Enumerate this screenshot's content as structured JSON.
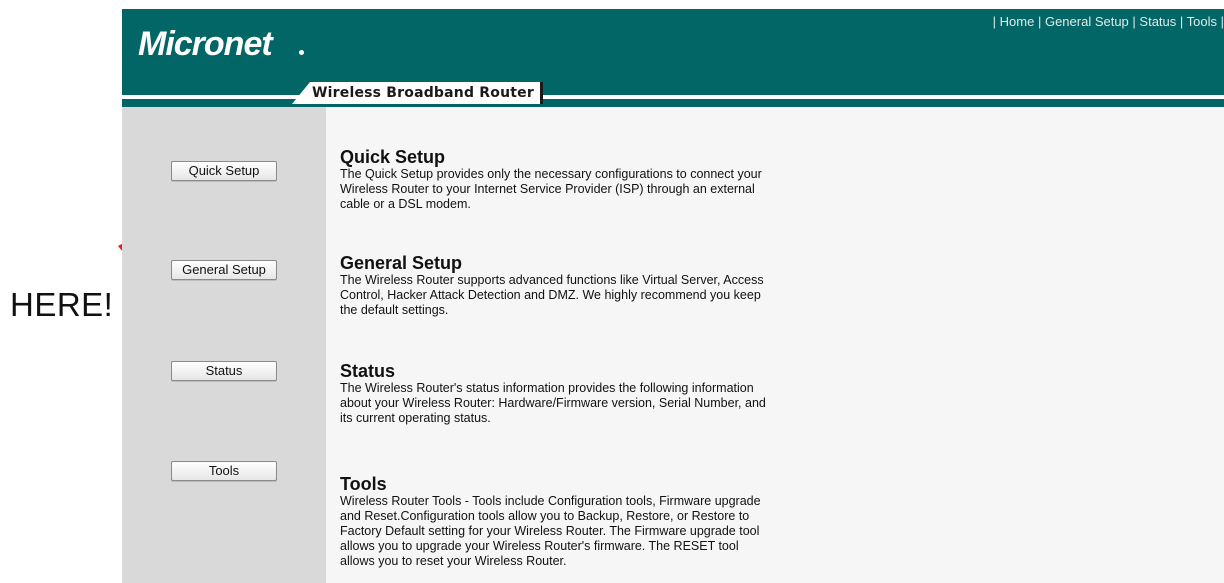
{
  "annotation": {
    "label": "HERE!",
    "arrow_color": "#ee1c1c"
  },
  "header": {
    "brand": "Micronet",
    "product": "Wireless Broadband Router",
    "links": [
      "Home",
      "General Setup",
      "Status",
      "Tools"
    ],
    "background": "#036666"
  },
  "sidebar": {
    "buttons": [
      {
        "label": "Quick Setup"
      },
      {
        "label": "General Setup"
      },
      {
        "label": "Status"
      },
      {
        "label": "Tools"
      }
    ]
  },
  "sections": [
    {
      "title": "Quick Setup",
      "lines": [
        "The Quick Setup provides only the necessary configurations to connect your",
        "Wireless Router to your Internet Service Provider (ISP) through an external",
        "cable or a DSL modem."
      ]
    },
    {
      "title": "General Setup",
      "lines": [
        "The Wireless Router supports advanced functions like Virtual Server, Access",
        "Control, Hacker Attack Detection and DMZ. We highly recommend you keep",
        "the default settings."
      ]
    },
    {
      "title": "Status",
      "lines": [
        "The Wireless Router's status information provides the following information",
        "about your Wireless Router: Hardware/Firmware version, Serial Number, and",
        "its current operating status."
      ]
    },
    {
      "title": "Tools",
      "lines": [
        "Wireless Router Tools - Tools include Configuration tools, Firmware upgrade",
        "and Reset.Configuration tools allow you to Backup, Restore, or Restore to",
        "Factory Default setting for your Wireless Router. The Firmware upgrade tool",
        "allows you to upgrade your Wireless Router's firmware. The RESET tool",
        "allows you to reset your Wireless Router."
      ]
    }
  ]
}
